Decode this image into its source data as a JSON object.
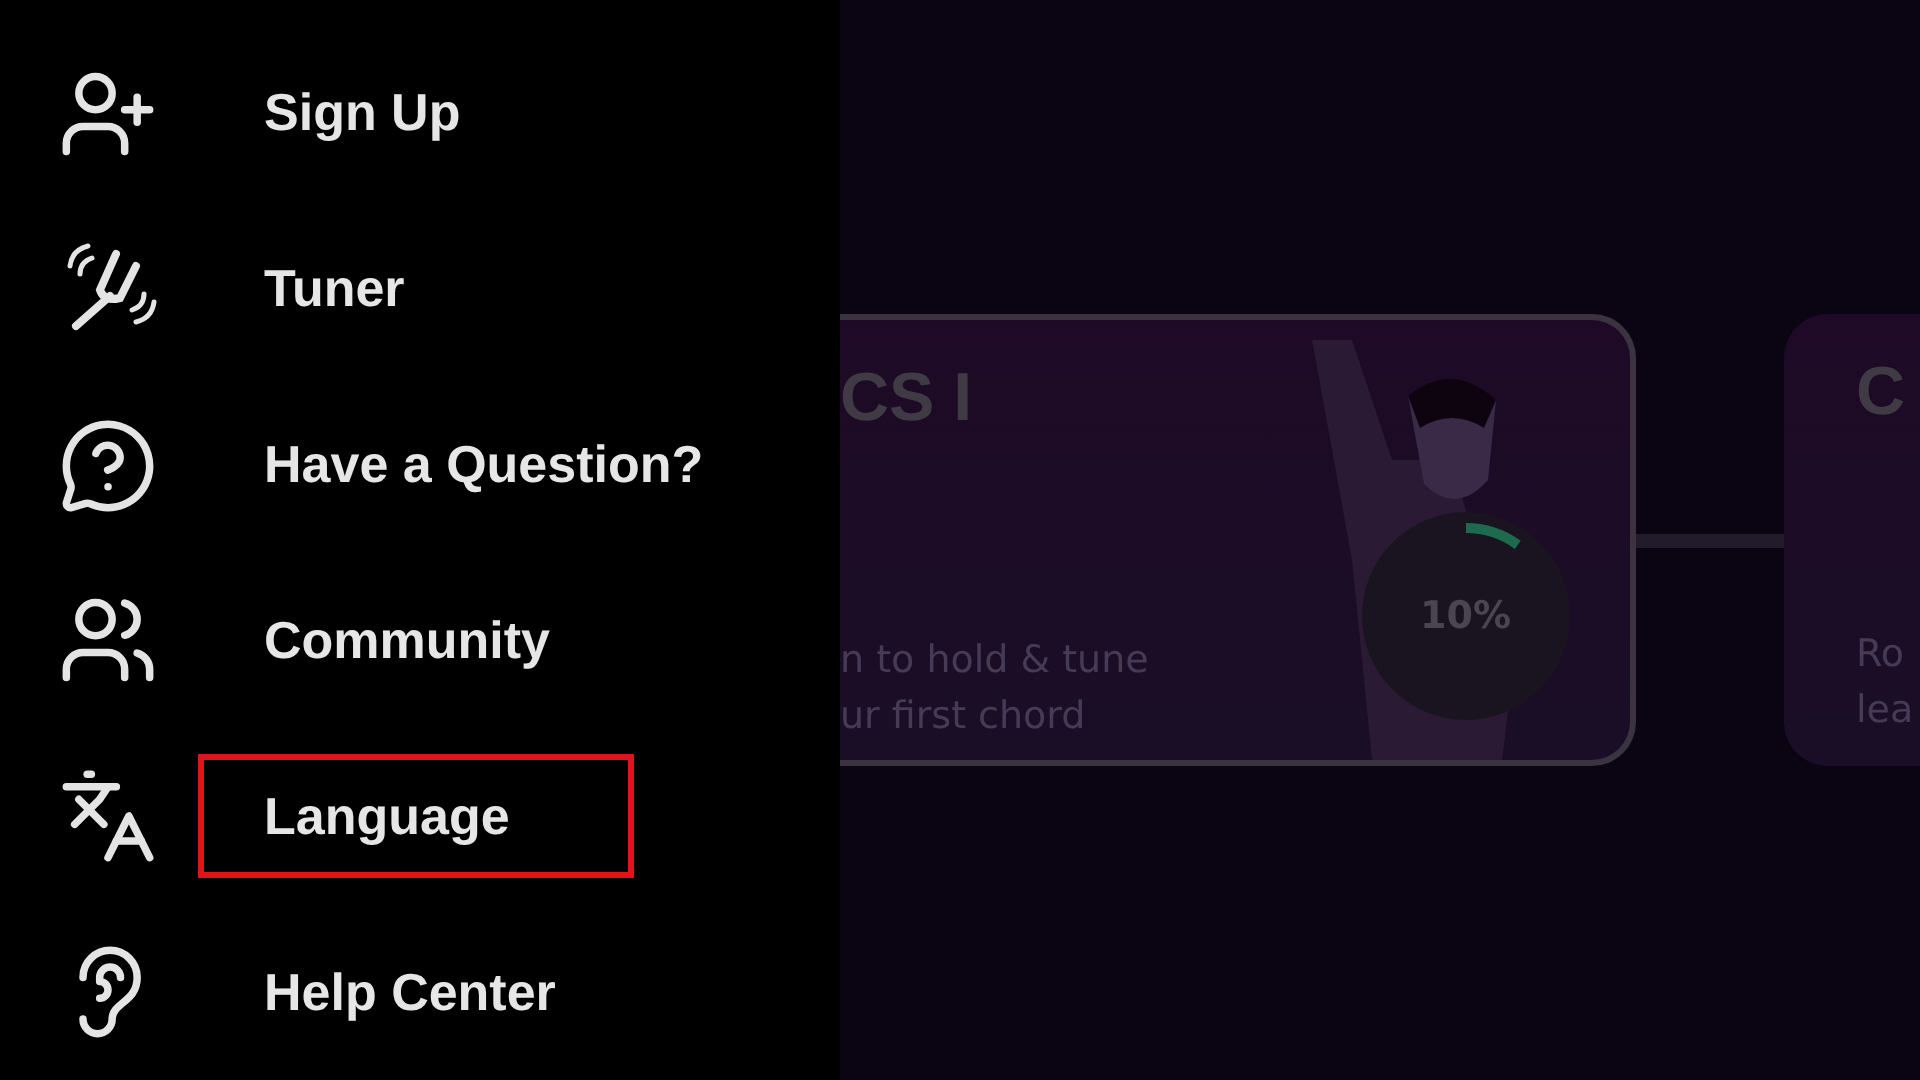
{
  "menu": {
    "items": [
      {
        "kind": "sign-up",
        "label": "Sign Up",
        "selected": false
      },
      {
        "kind": "tuner",
        "label": "Tuner",
        "selected": false
      },
      {
        "kind": "question",
        "label": "Have a Question?",
        "selected": false
      },
      {
        "kind": "community",
        "label": "Community",
        "selected": false
      },
      {
        "kind": "language",
        "label": "Language",
        "selected": true
      },
      {
        "kind": "help",
        "label": "Help Center",
        "selected": false
      }
    ]
  },
  "courses": [
    {
      "title": "CS I",
      "description": [
        "n to hold & tune",
        "ur first chord"
      ],
      "progress": {
        "level": 0.1,
        "label": "10%"
      }
    },
    {
      "title": "C",
      "description": [
        "Ro",
        "lea"
      ]
    }
  ]
}
